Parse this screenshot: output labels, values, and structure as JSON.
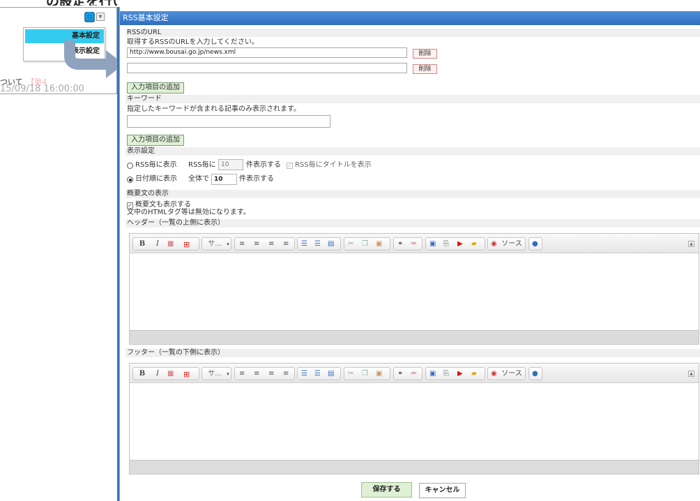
{
  "background": {
    "heading": "の設定を行います。",
    "text_snippet": "ついて",
    "text_snippet_faded": "【第4",
    "date": "15/09/18 16:00:00",
    "menu": {
      "item_basic": "基本設定",
      "item_display": "表示設定"
    }
  },
  "dialog": {
    "title": "RSS基本設定",
    "rss_url": {
      "section": "RSSのURL",
      "hint": "取得するRSSのURLを入力してください。",
      "url_1": "http://www.bousai.go.jp/news.xml",
      "url_2": "",
      "delete_label": "削除",
      "add_label": "入力項目の追加"
    },
    "keyword": {
      "section": "キーワード",
      "hint": "指定したキーワードが含まれる記事のみ表示されます。",
      "value": "",
      "add_label": "入力項目の追加"
    },
    "display": {
      "section": "表示設定",
      "opt1_label": "RSS毎に表示",
      "opt1_prefix": "RSS毎に",
      "opt1_count": "10",
      "opt1_suffix": "件表示する",
      "opt1_title_check": "RSS毎にタイトルを表示",
      "opt2_label": "日付順に表示",
      "opt2_prefix": "全体で",
      "opt2_count": "10",
      "opt2_suffix": "件表示する"
    },
    "summary": {
      "section": "概要文の表示",
      "check_label": "概要文も表示する",
      "note": "文中のHTMLタグ等は無効になります。"
    },
    "header_editor": {
      "section": "ヘッダー（一覧の上側に表示）"
    },
    "footer_editor": {
      "section": "フッター（一覧の下側に表示）"
    },
    "toolbar": {
      "bold": "B",
      "italic": "I",
      "size": "サ...",
      "source": "ソース"
    },
    "buttons": {
      "save": "保存する",
      "cancel": "キャンセル"
    }
  },
  "colors": {
    "titlebar": "#3a7bd0",
    "section_bg": "#f0f0f0",
    "add_button": "#dff0d5",
    "delete_button": "#fff0ec",
    "menu_active": "#33ccf0"
  }
}
